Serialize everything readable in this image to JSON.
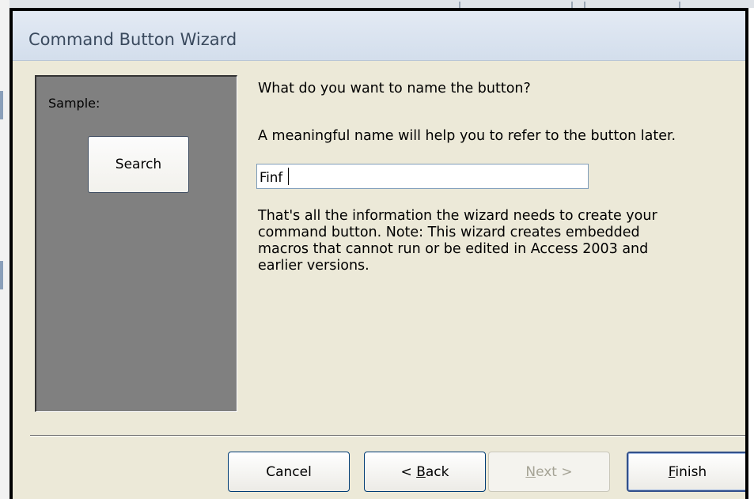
{
  "dialog": {
    "title": "Command Button Wizard"
  },
  "sample_panel": {
    "label": "Sample:",
    "button_label": "Search"
  },
  "content": {
    "question": "What do you want to name the button?",
    "hint": "A meaningful name will help you to refer to the button later.",
    "name_value": "Finf",
    "info_lines": [
      "That's all the information the wizard needs to create your",
      "command button. Note: This wizard creates embedded",
      "macros that cannot run or be edited in Access 2003 and",
      "earlier versions."
    ]
  },
  "buttons": {
    "cancel": {
      "label": "Cancel"
    },
    "back": {
      "prefix": "< ",
      "accel": "B",
      "rest": "ack"
    },
    "next": {
      "accel": "N",
      "rest": "ext >"
    },
    "finish": {
      "accel": "F",
      "rest": "inish"
    }
  },
  "colors": {
    "dialog_bg": "#ece9d8",
    "sample_panel_bg": "#808080",
    "title_text": "#3a4a5e",
    "button_border": "#003c74"
  }
}
